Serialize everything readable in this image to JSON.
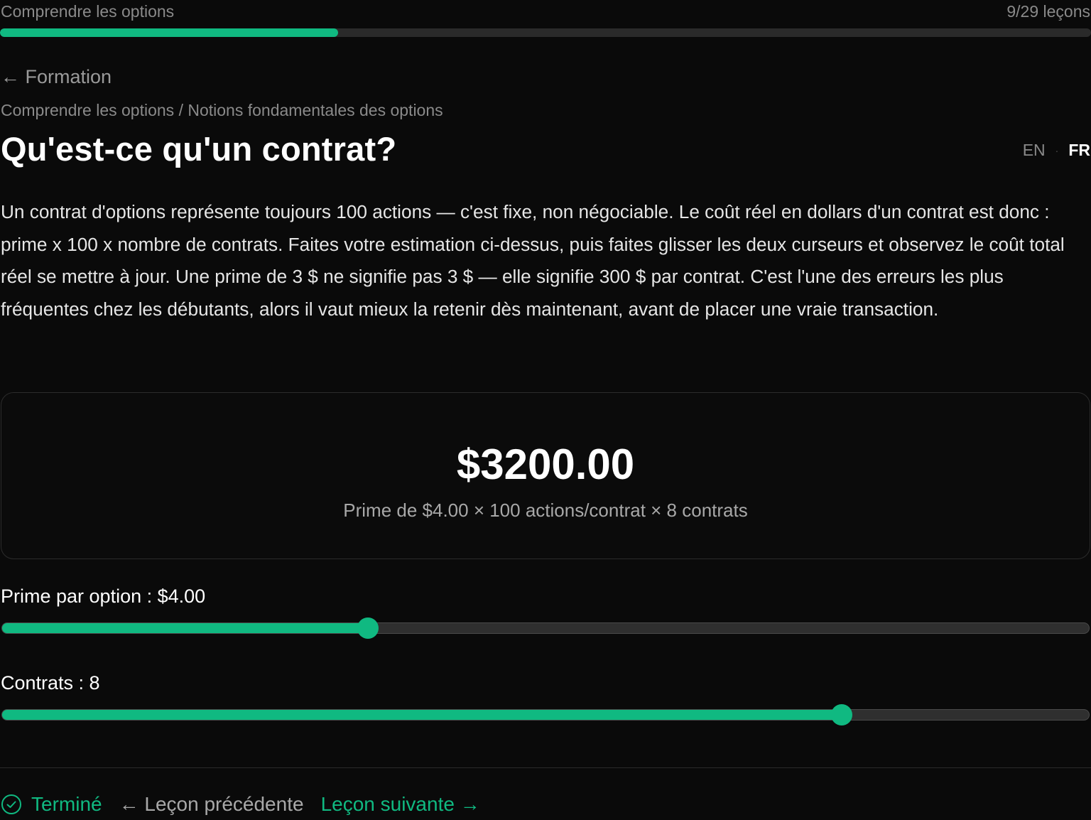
{
  "header": {
    "course_title": "Comprendre les options",
    "lesson_count": "9/29 leçons",
    "progress_fraction": 0.31
  },
  "nav": {
    "back_label": "← Formation"
  },
  "breadcrumb": "Comprendre les options / Notions fondamentales des options",
  "title": "Qu'est-ce qu'un contrat?",
  "language": {
    "en": "EN",
    "separator": "·",
    "fr": "FR",
    "active": "FR"
  },
  "body_text": "Un contrat d'options représente toujours 100 actions — c'est fixe, non négociable. Le coût réel en dollars d'un contrat est donc : prime x 100 x nombre de contrats. Faites votre estimation ci-dessus, puis faites glisser les deux curseurs et observez le coût total réel se mettre à jour. Une prime de 3 $ ne signifie pas 3 $ — elle signifie 300 $ par contrat. C'est l'une des erreurs les plus fréquentes chez les débutants, alors il vaut mieux la retenir dès maintenant, avant de placer une vraie transaction.",
  "calculator": {
    "total": "$3200.00",
    "formula": "Prime de $4.00 × 100 actions/contrat × 8 contrats"
  },
  "sliders": {
    "premium": {
      "label": "Prime par option : $4.00",
      "fraction": 0.337
    },
    "contracts": {
      "label": "Contrats : 8",
      "fraction": 0.772
    }
  },
  "footer": {
    "done_label": "Terminé",
    "prev_label": "← Leçon précédente",
    "next_label": "Leçon suivante →"
  },
  "colors": {
    "accent": "#10b981",
    "background": "#0a0a0a",
    "muted_text": "#8a8a8a"
  },
  "icons": {
    "done": "check-circle-icon"
  }
}
